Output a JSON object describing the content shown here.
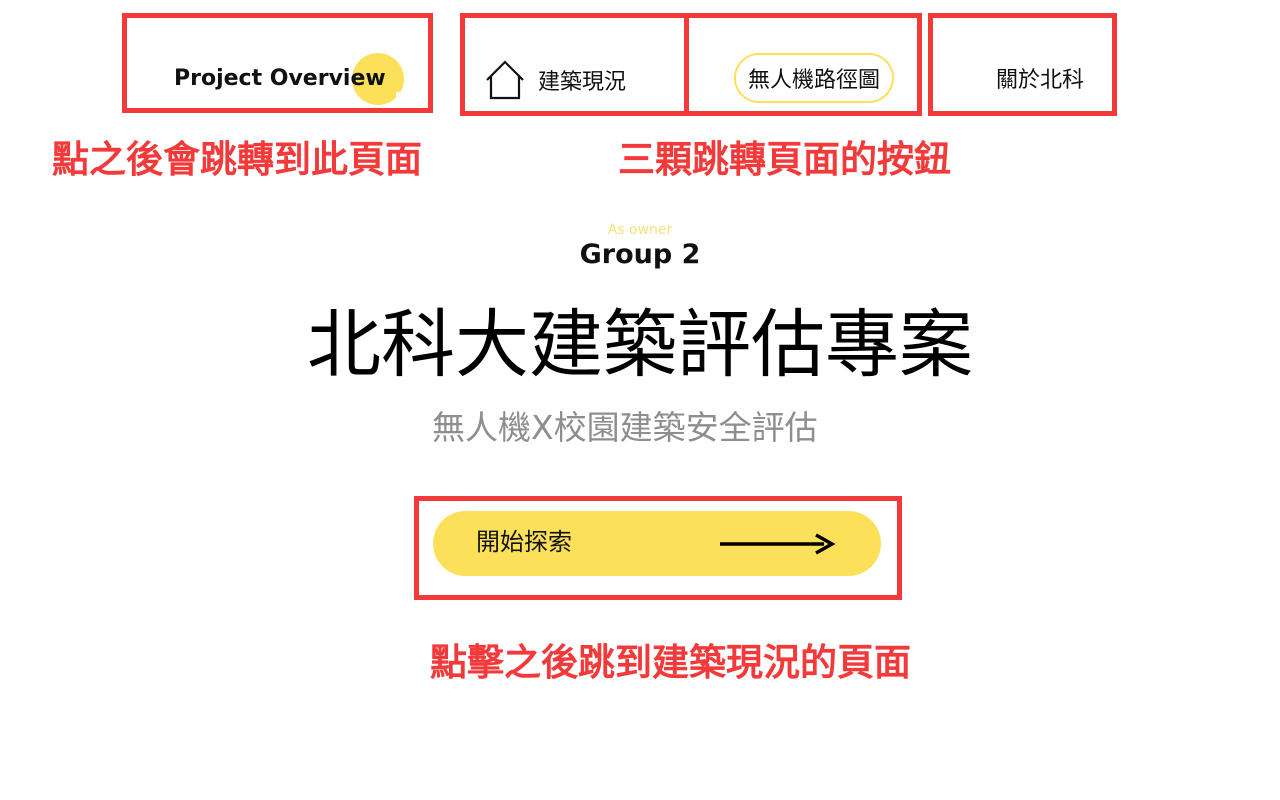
{
  "nav": {
    "brand": "Project Overview",
    "items": [
      {
        "label": "建築現況",
        "icon": "home-icon"
      },
      {
        "label": "無人機路徑圖"
      },
      {
        "label": "關於北科"
      }
    ]
  },
  "hero": {
    "eyebrow": "As owner",
    "group": "Group 2",
    "title": "北科大建築評估專案",
    "subtitle": "無人機X校園建築安全評估"
  },
  "cta": {
    "label": "開始探索",
    "icon": "arrow-right-icon"
  },
  "annotations": {
    "overview_note": "點之後會跳轉到此頁面",
    "nav_note": "三顆跳轉頁面的按鈕",
    "cta_note": "點擊之後跳到建築現況的頁面"
  },
  "colors": {
    "accent_yellow": "#fde05a",
    "annotation_red": "#f23a3a",
    "subtitle_gray": "#8e8e8e",
    "eyebrow_yellow": "#f5e27a"
  }
}
